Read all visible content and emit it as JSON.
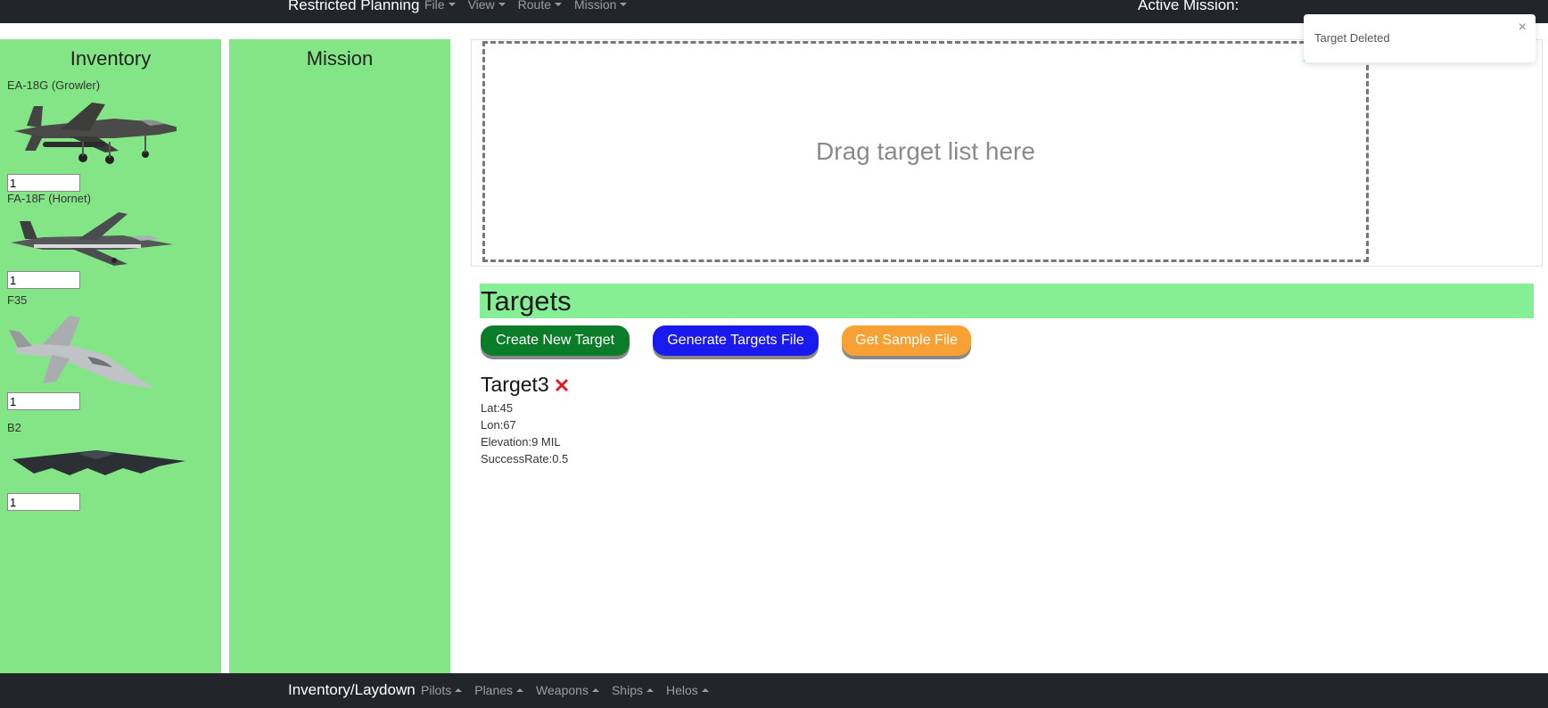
{
  "top_nav": {
    "brand": "Restricted Planning",
    "menus": [
      "File",
      "View",
      "Route",
      "Mission"
    ],
    "active_mission_label": "Active Mission:"
  },
  "bottom_nav": {
    "brand": "Inventory/Laydown",
    "menus": [
      "Pilots",
      "Planes",
      "Weapons",
      "Ships",
      "Helos"
    ]
  },
  "inventory": {
    "title": "Inventory",
    "items": [
      {
        "label": "EA-18G (Growler)",
        "qty": "1",
        "icon": "jet-growler-image"
      },
      {
        "label": "FA-18F (Hornet)",
        "qty": "1",
        "icon": "jet-hornet-image"
      },
      {
        "label": "F35",
        "qty": "1",
        "icon": "jet-f35-image"
      },
      {
        "label": "B2",
        "qty": "1",
        "icon": "bomber-b2-image"
      }
    ]
  },
  "mission": {
    "title": "Mission"
  },
  "dropzone": {
    "text": "Drag target list here"
  },
  "targets": {
    "title": "Targets",
    "buttons": {
      "create": "Create New Target",
      "generate": "Generate Targets File",
      "sample": "Get Sample File"
    },
    "list": [
      {
        "name": "Target3",
        "lat": "Lat:45",
        "lon": "Lon:67",
        "elevation": "Elevation:9 MIL",
        "success": "SuccessRate:0.5"
      }
    ]
  },
  "toast": {
    "message": "Target Deleted",
    "close": "×"
  },
  "colors": {
    "navbar": "#222529",
    "panel": "#83e585",
    "targets_header": "#86ef96",
    "btn_green": "#0b7d2a",
    "btn_blue": "#1a1aee",
    "btn_orange": "#f7a033",
    "delete_red": "#e8141c"
  }
}
